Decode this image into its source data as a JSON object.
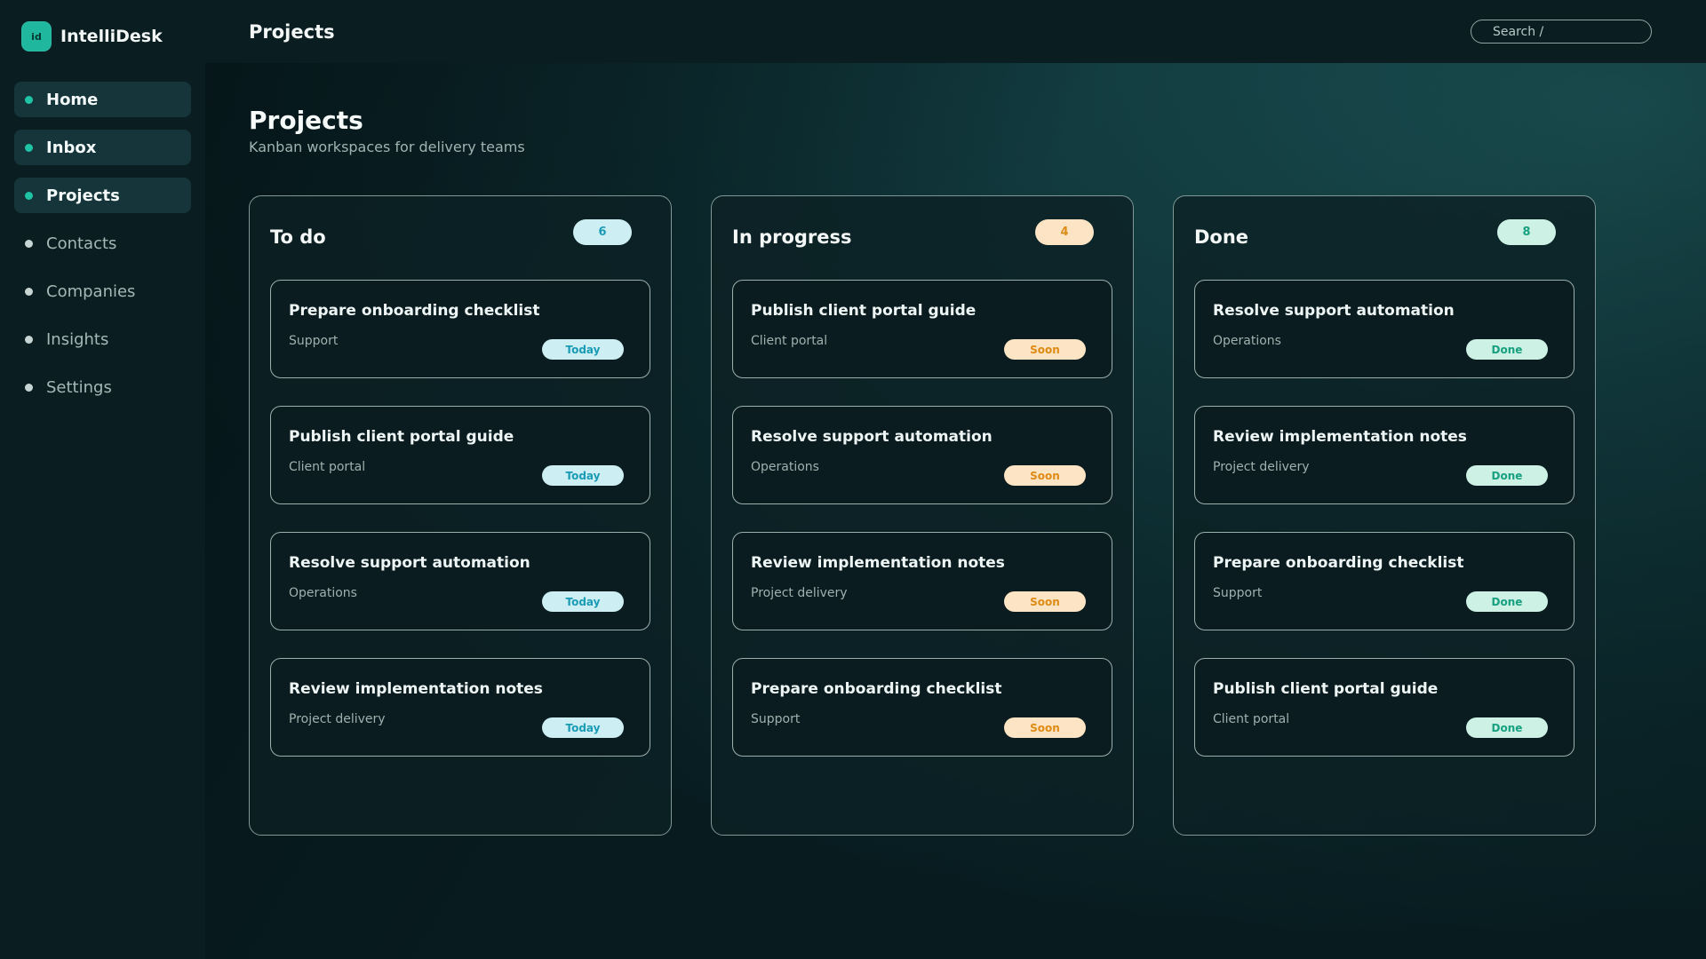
{
  "app": {
    "logo_text": "id",
    "name": "IntelliDesk"
  },
  "sidebar": {
    "items": [
      {
        "label": "Home",
        "active": true
      },
      {
        "label": "Inbox",
        "active": true
      },
      {
        "label": "Projects",
        "active": true
      },
      {
        "label": "Contacts",
        "active": false
      },
      {
        "label": "Companies",
        "active": false
      },
      {
        "label": "Insights",
        "active": false
      },
      {
        "label": "Settings",
        "active": false
      }
    ]
  },
  "topbar": {
    "title": "Projects",
    "search_placeholder": "Search /"
  },
  "page": {
    "title": "Projects",
    "subtitle": "Kanban workspaces for delivery teams"
  },
  "colors": {
    "accent": "#1fb89f",
    "today_bg": "#cdeff3",
    "today_fg": "#1a9bb5",
    "soon_bg": "#fde4c4",
    "soon_fg": "#e08b14",
    "done_bg": "#cdf2e5",
    "done_fg": "#16a07f"
  },
  "columns": [
    {
      "title": "To do",
      "count": "6",
      "cards": [
        {
          "title": "Prepare onboarding checklist",
          "meta": "Support",
          "badge": "Today"
        },
        {
          "title": "Publish client portal guide",
          "meta": "Client portal",
          "badge": "Today"
        },
        {
          "title": "Resolve support automation",
          "meta": "Operations",
          "badge": "Today"
        },
        {
          "title": "Review implementation notes",
          "meta": "Project delivery",
          "badge": "Today"
        }
      ]
    },
    {
      "title": "In progress",
      "count": "4",
      "cards": [
        {
          "title": "Publish client portal guide",
          "meta": "Client portal",
          "badge": "Soon"
        },
        {
          "title": "Resolve support automation",
          "meta": "Operations",
          "badge": "Soon"
        },
        {
          "title": "Review implementation notes",
          "meta": "Project delivery",
          "badge": "Soon"
        },
        {
          "title": "Prepare onboarding checklist",
          "meta": "Support",
          "badge": "Soon"
        }
      ]
    },
    {
      "title": "Done",
      "count": "8",
      "cards": [
        {
          "title": "Resolve support automation",
          "meta": "Operations",
          "badge": "Done"
        },
        {
          "title": "Review implementation notes",
          "meta": "Project delivery",
          "badge": "Done"
        },
        {
          "title": "Prepare onboarding checklist",
          "meta": "Support",
          "badge": "Done"
        },
        {
          "title": "Publish client portal guide",
          "meta": "Client portal",
          "badge": "Done"
        }
      ]
    }
  ]
}
